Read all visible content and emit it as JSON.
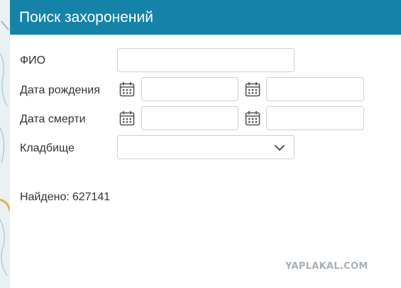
{
  "panel": {
    "title": "Поиск захоронений"
  },
  "form": {
    "fio": {
      "label": "ФИО",
      "value": ""
    },
    "birth": {
      "label": "Дата рождения",
      "from": "",
      "to": ""
    },
    "death": {
      "label": "Дата смерти",
      "from": "",
      "to": ""
    },
    "cemetery": {
      "label": "Кладбище",
      "selected": ""
    }
  },
  "results": {
    "found_label": "Найдено:",
    "found_count": "627141"
  },
  "watermark": "YAPLAKAL.COM",
  "colors": {
    "header_bg": "#1583a8",
    "header_text": "#ffffff"
  },
  "icons": {
    "date_picker": "calendar-icon",
    "dropdown": "chevron-down-icon"
  }
}
